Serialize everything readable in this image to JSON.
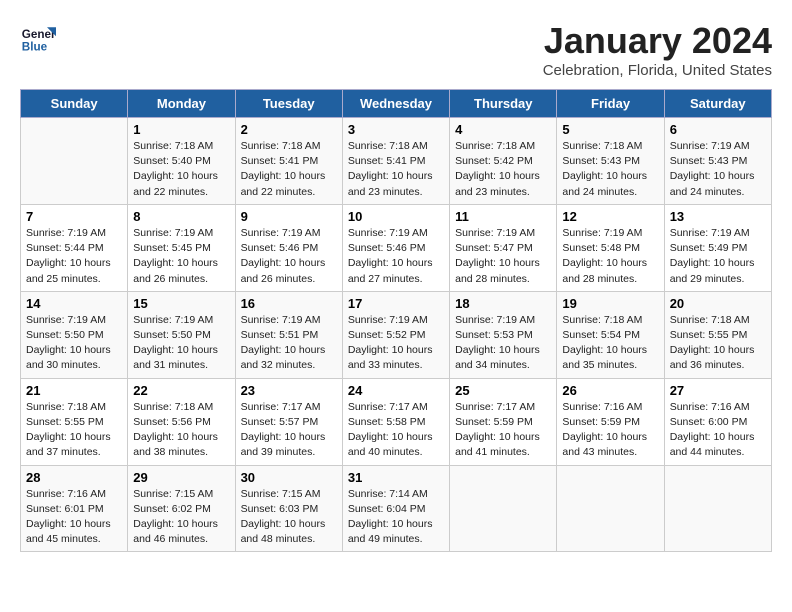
{
  "header": {
    "logo_line1": "General",
    "logo_line2": "Blue",
    "title": "January 2024",
    "subtitle": "Celebration, Florida, United States"
  },
  "weekdays": [
    "Sunday",
    "Monday",
    "Tuesday",
    "Wednesday",
    "Thursday",
    "Friday",
    "Saturday"
  ],
  "weeks": [
    [
      {
        "day": "",
        "info": ""
      },
      {
        "day": "1",
        "info": "Sunrise: 7:18 AM\nSunset: 5:40 PM\nDaylight: 10 hours\nand 22 minutes."
      },
      {
        "day": "2",
        "info": "Sunrise: 7:18 AM\nSunset: 5:41 PM\nDaylight: 10 hours\nand 22 minutes."
      },
      {
        "day": "3",
        "info": "Sunrise: 7:18 AM\nSunset: 5:41 PM\nDaylight: 10 hours\nand 23 minutes."
      },
      {
        "day": "4",
        "info": "Sunrise: 7:18 AM\nSunset: 5:42 PM\nDaylight: 10 hours\nand 23 minutes."
      },
      {
        "day": "5",
        "info": "Sunrise: 7:18 AM\nSunset: 5:43 PM\nDaylight: 10 hours\nand 24 minutes."
      },
      {
        "day": "6",
        "info": "Sunrise: 7:19 AM\nSunset: 5:43 PM\nDaylight: 10 hours\nand 24 minutes."
      }
    ],
    [
      {
        "day": "7",
        "info": "Sunrise: 7:19 AM\nSunset: 5:44 PM\nDaylight: 10 hours\nand 25 minutes."
      },
      {
        "day": "8",
        "info": "Sunrise: 7:19 AM\nSunset: 5:45 PM\nDaylight: 10 hours\nand 26 minutes."
      },
      {
        "day": "9",
        "info": "Sunrise: 7:19 AM\nSunset: 5:46 PM\nDaylight: 10 hours\nand 26 minutes."
      },
      {
        "day": "10",
        "info": "Sunrise: 7:19 AM\nSunset: 5:46 PM\nDaylight: 10 hours\nand 27 minutes."
      },
      {
        "day": "11",
        "info": "Sunrise: 7:19 AM\nSunset: 5:47 PM\nDaylight: 10 hours\nand 28 minutes."
      },
      {
        "day": "12",
        "info": "Sunrise: 7:19 AM\nSunset: 5:48 PM\nDaylight: 10 hours\nand 28 minutes."
      },
      {
        "day": "13",
        "info": "Sunrise: 7:19 AM\nSunset: 5:49 PM\nDaylight: 10 hours\nand 29 minutes."
      }
    ],
    [
      {
        "day": "14",
        "info": "Sunrise: 7:19 AM\nSunset: 5:50 PM\nDaylight: 10 hours\nand 30 minutes."
      },
      {
        "day": "15",
        "info": "Sunrise: 7:19 AM\nSunset: 5:50 PM\nDaylight: 10 hours\nand 31 minutes."
      },
      {
        "day": "16",
        "info": "Sunrise: 7:19 AM\nSunset: 5:51 PM\nDaylight: 10 hours\nand 32 minutes."
      },
      {
        "day": "17",
        "info": "Sunrise: 7:19 AM\nSunset: 5:52 PM\nDaylight: 10 hours\nand 33 minutes."
      },
      {
        "day": "18",
        "info": "Sunrise: 7:19 AM\nSunset: 5:53 PM\nDaylight: 10 hours\nand 34 minutes."
      },
      {
        "day": "19",
        "info": "Sunrise: 7:18 AM\nSunset: 5:54 PM\nDaylight: 10 hours\nand 35 minutes."
      },
      {
        "day": "20",
        "info": "Sunrise: 7:18 AM\nSunset: 5:55 PM\nDaylight: 10 hours\nand 36 minutes."
      }
    ],
    [
      {
        "day": "21",
        "info": "Sunrise: 7:18 AM\nSunset: 5:55 PM\nDaylight: 10 hours\nand 37 minutes."
      },
      {
        "day": "22",
        "info": "Sunrise: 7:18 AM\nSunset: 5:56 PM\nDaylight: 10 hours\nand 38 minutes."
      },
      {
        "day": "23",
        "info": "Sunrise: 7:17 AM\nSunset: 5:57 PM\nDaylight: 10 hours\nand 39 minutes."
      },
      {
        "day": "24",
        "info": "Sunrise: 7:17 AM\nSunset: 5:58 PM\nDaylight: 10 hours\nand 40 minutes."
      },
      {
        "day": "25",
        "info": "Sunrise: 7:17 AM\nSunset: 5:59 PM\nDaylight: 10 hours\nand 41 minutes."
      },
      {
        "day": "26",
        "info": "Sunrise: 7:16 AM\nSunset: 5:59 PM\nDaylight: 10 hours\nand 43 minutes."
      },
      {
        "day": "27",
        "info": "Sunrise: 7:16 AM\nSunset: 6:00 PM\nDaylight: 10 hours\nand 44 minutes."
      }
    ],
    [
      {
        "day": "28",
        "info": "Sunrise: 7:16 AM\nSunset: 6:01 PM\nDaylight: 10 hours\nand 45 minutes."
      },
      {
        "day": "29",
        "info": "Sunrise: 7:15 AM\nSunset: 6:02 PM\nDaylight: 10 hours\nand 46 minutes."
      },
      {
        "day": "30",
        "info": "Sunrise: 7:15 AM\nSunset: 6:03 PM\nDaylight: 10 hours\nand 48 minutes."
      },
      {
        "day": "31",
        "info": "Sunrise: 7:14 AM\nSunset: 6:04 PM\nDaylight: 10 hours\nand 49 minutes."
      },
      {
        "day": "",
        "info": ""
      },
      {
        "day": "",
        "info": ""
      },
      {
        "day": "",
        "info": ""
      }
    ]
  ]
}
